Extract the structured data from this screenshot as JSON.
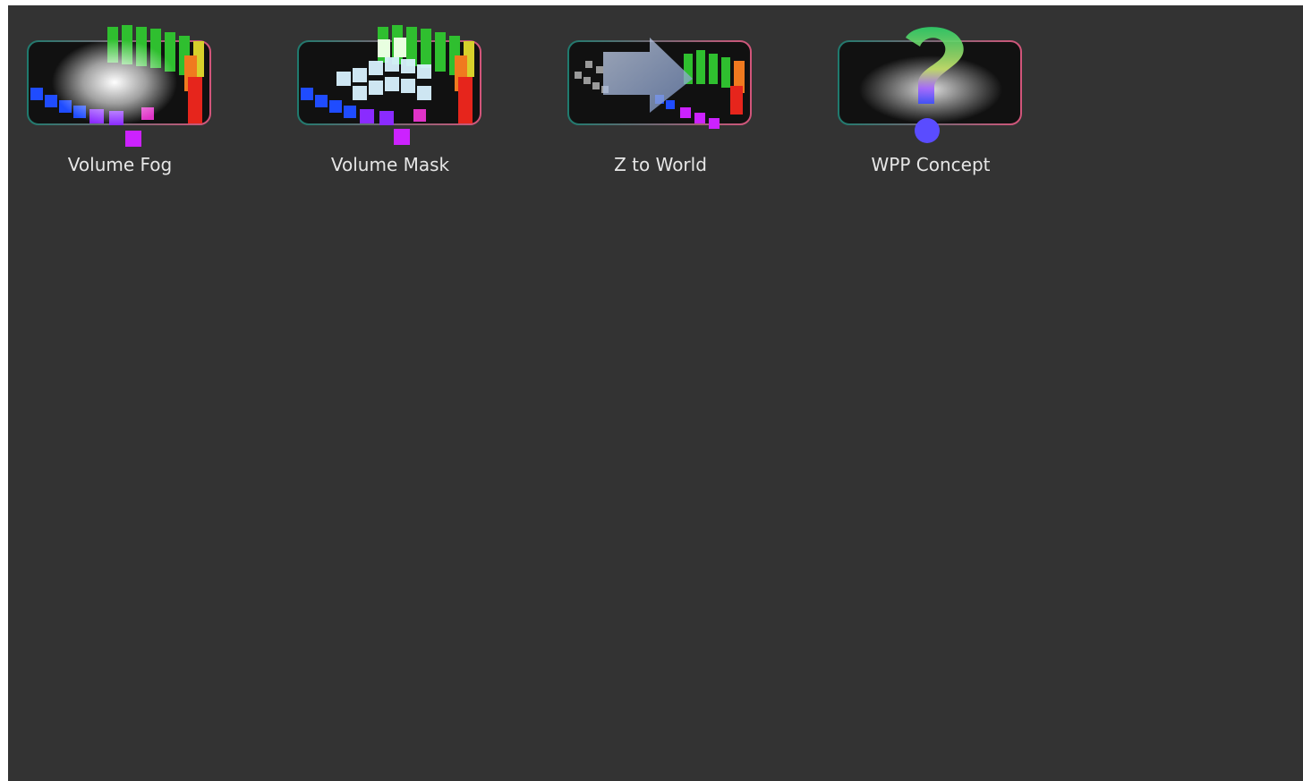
{
  "browser": {
    "items": [
      {
        "label": "Volume Fog",
        "icon": "volume-fog-icon"
      },
      {
        "label": "Volume Mask",
        "icon": "volume-mask-icon"
      },
      {
        "label": "Z to World",
        "icon": "z-to-world-icon"
      },
      {
        "label": "WPP Concept",
        "icon": "wpp-concept-icon"
      }
    ]
  },
  "colors": {
    "background": "#333333",
    "label_text": "#e6e6e6",
    "frame_left": "#1f7a6e",
    "frame_right": "#d2557a"
  }
}
